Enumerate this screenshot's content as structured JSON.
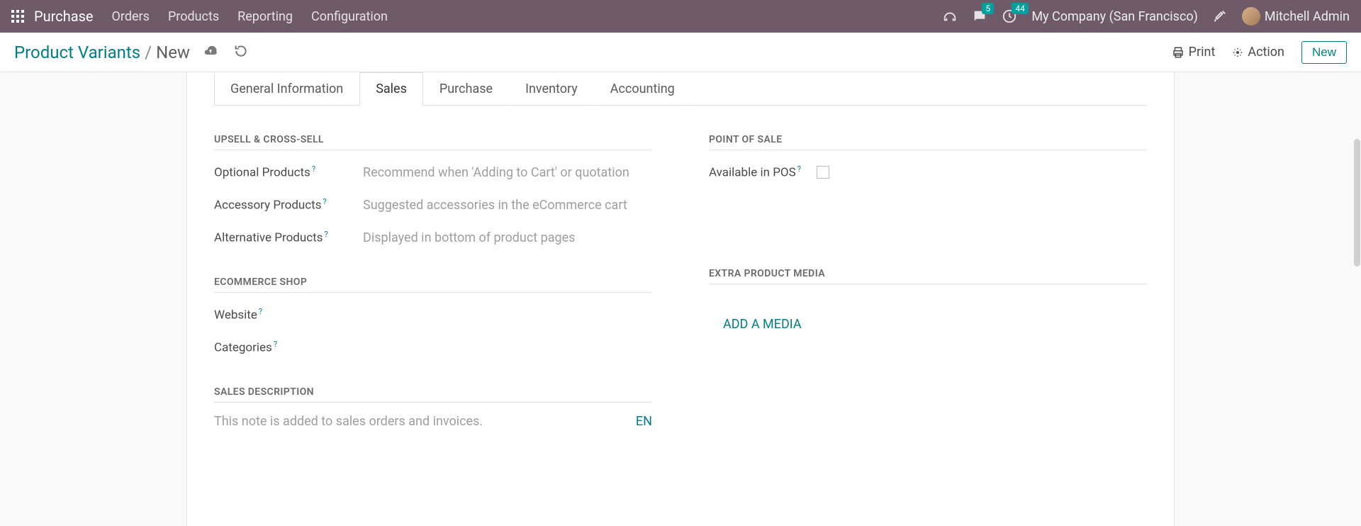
{
  "topbar": {
    "app_name": "Purchase",
    "menu": [
      "Orders",
      "Products",
      "Reporting",
      "Configuration"
    ],
    "messages_count": "5",
    "activities_count": "44",
    "company": "My Company (San Francisco)",
    "user": "Mitchell Admin"
  },
  "breadcrumb": {
    "parent": "Product Variants",
    "current": "New"
  },
  "actions": {
    "print": "Print",
    "action": "Action",
    "new": "New"
  },
  "tabs": [
    "General Information",
    "Sales",
    "Purchase",
    "Inventory",
    "Accounting"
  ],
  "active_tab": "Sales",
  "sections": {
    "upsell": {
      "title": "UPSELL & CROSS-SELL",
      "optional_label": "Optional Products",
      "optional_placeholder": "Recommend when 'Adding to Cart' or quotation",
      "accessory_label": "Accessory Products",
      "accessory_placeholder": "Suggested accessories in the eCommerce cart",
      "alternative_label": "Alternative Products",
      "alternative_placeholder": "Displayed in bottom of product pages"
    },
    "shop": {
      "title": "ECOMMERCE SHOP",
      "website_label": "Website",
      "categories_label": "Categories"
    },
    "salesdesc": {
      "title": "SALES DESCRIPTION",
      "placeholder": "This note is added to sales orders and invoices.",
      "lang": "EN"
    },
    "pos": {
      "title": "POINT OF SALE",
      "available_label": "Available in POS"
    },
    "media": {
      "title": "EXTRA PRODUCT MEDIA",
      "add_label": "ADD A MEDIA"
    }
  }
}
